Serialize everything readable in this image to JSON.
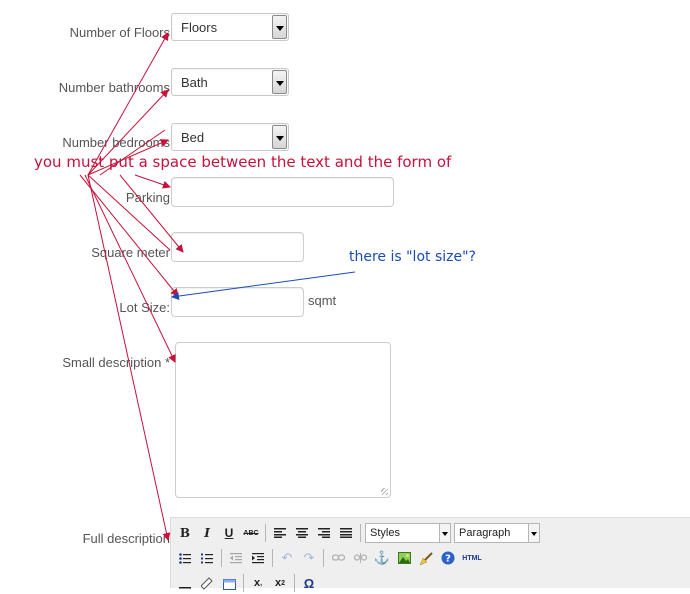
{
  "form": {
    "floors": {
      "label": "Number of Floors",
      "value": "Floors"
    },
    "bathrooms": {
      "label": "Number bathrooms",
      "value": "Bath"
    },
    "bedrooms": {
      "label": "Number bedrooms",
      "value": "Bed"
    },
    "parking": {
      "label": "Parking",
      "value": ""
    },
    "square_meter": {
      "label": "Square meter",
      "value": ""
    },
    "lot_size": {
      "label": "Lot Size:",
      "value": "",
      "unit": "sqmt"
    },
    "small_description": {
      "label": "Small description",
      "required_mark": "*",
      "value": ""
    },
    "full_description": {
      "label": "Full description"
    }
  },
  "editor": {
    "styles_label": "Styles",
    "format_label": "Paragraph",
    "row1_icons": [
      "bold-icon",
      "italic-icon",
      "underline-icon",
      "strikethrough-icon",
      "align-left-icon",
      "align-center-icon",
      "align-right-icon",
      "align-justify-icon"
    ],
    "row2_icons": [
      "bullet-list-icon",
      "numbered-list-icon",
      "outdent-icon",
      "indent-icon",
      "undo-icon",
      "redo-icon",
      "link-icon",
      "unlink-icon",
      "anchor-icon",
      "image-icon",
      "cleanup-icon",
      "help-icon",
      "html-icon"
    ],
    "row2_html_label": "HTML",
    "row3_icons": [
      "horizontal-rule-icon",
      "eraser-icon",
      "table-icon",
      "subscript-icon",
      "superscript-icon",
      "special-char-icon"
    ]
  },
  "annotations": {
    "red_note": "you must put a space between the text and the form of",
    "blue_note": "there is \"lot size\"?",
    "red_color": "#c8103a",
    "blue_color": "#1a4ab8"
  }
}
